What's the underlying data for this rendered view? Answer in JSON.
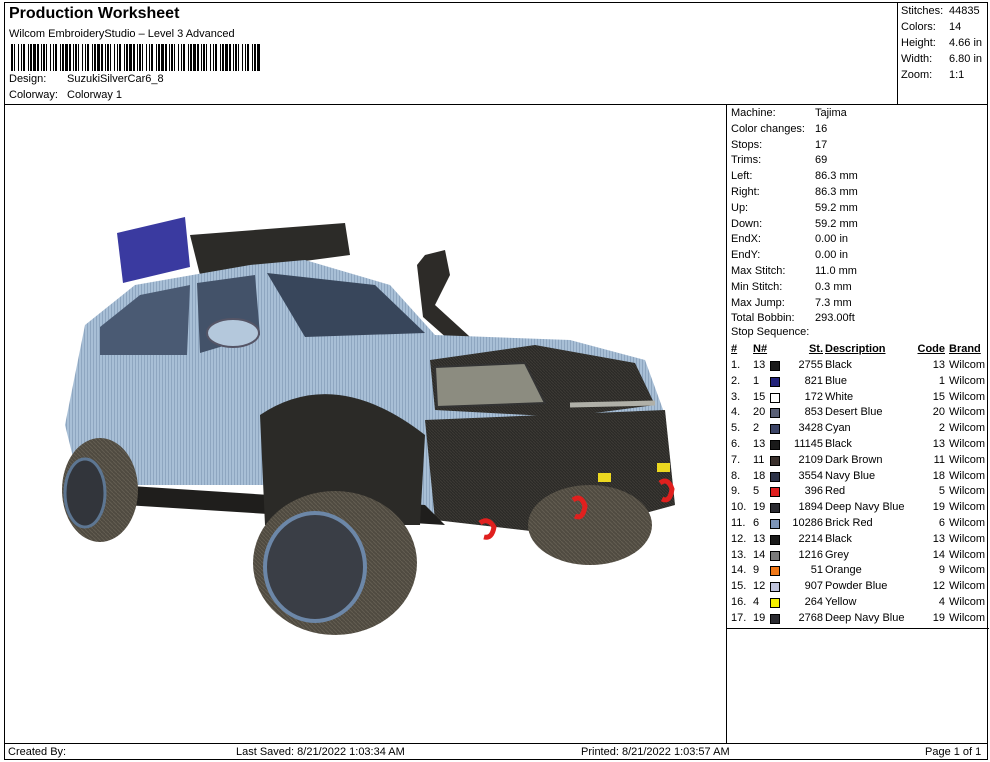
{
  "header": {
    "title": "Production Worksheet",
    "subtitle": "Wilcom EmbroideryStudio – Level 3 Advanced",
    "design_label": "Design:",
    "design_value": "SuzukiSilverCar6_8",
    "colorway_label": "Colorway:",
    "colorway_value": "Colorway 1"
  },
  "info": [
    {
      "label": "Stitches:",
      "value": "44835"
    },
    {
      "label": "Colors:",
      "value": "14"
    },
    {
      "label": "Height:",
      "value": "4.66 in"
    },
    {
      "label": "Width:",
      "value": "6.80 in"
    },
    {
      "label": "Zoom:",
      "value": "1:1"
    }
  ],
  "machine": [
    {
      "label": "Machine:",
      "value": "Tajima"
    },
    {
      "label": "Color changes:",
      "value": "16"
    },
    {
      "label": "Stops:",
      "value": "17"
    },
    {
      "label": "Trims:",
      "value": "69"
    },
    {
      "label": "Left:",
      "value": "86.3 mm"
    },
    {
      "label": "Right:",
      "value": "86.3 mm"
    },
    {
      "label": "Up:",
      "value": "59.2 mm"
    },
    {
      "label": "Down:",
      "value": "59.2 mm"
    },
    {
      "label": "EndX:",
      "value": "0.00 in"
    },
    {
      "label": "EndY:",
      "value": "0.00 in"
    },
    {
      "label": "Max Stitch:",
      "value": "11.0 mm"
    },
    {
      "label": "Min Stitch:",
      "value": "0.3 mm"
    },
    {
      "label": "Max Jump:",
      "value": "7.3 mm"
    },
    {
      "label": "Total Bobbin:",
      "value": "293.00ft"
    }
  ],
  "stop_sequence": {
    "title": "Stop Sequence:",
    "headers": {
      "idx": "#",
      "n": "N#",
      "st": "St.",
      "desc": "Description",
      "code": "Code",
      "brand": "Brand"
    },
    "rows": [
      {
        "idx": "1.",
        "n": "13",
        "color": "#1a1a1a",
        "st": "2755",
        "desc": "Black",
        "code": "13",
        "brand": "Wilcom"
      },
      {
        "idx": "2.",
        "n": "1",
        "color": "#22227a",
        "st": "821",
        "desc": "Blue",
        "code": "1",
        "brand": "Wilcom"
      },
      {
        "idx": "3.",
        "n": "15",
        "color": "#ffffff",
        "st": "172",
        "desc": "White",
        "code": "15",
        "brand": "Wilcom"
      },
      {
        "idx": "4.",
        "n": "20",
        "color": "#5a6076",
        "st": "853",
        "desc": "Desert Blue",
        "code": "20",
        "brand": "Wilcom"
      },
      {
        "idx": "5.",
        "n": "2",
        "color": "#3c4466",
        "st": "3428",
        "desc": "Cyan",
        "code": "2",
        "brand": "Wilcom"
      },
      {
        "idx": "6.",
        "n": "13",
        "color": "#1a1a1a",
        "st": "11145",
        "desc": "Black",
        "code": "13",
        "brand": "Wilcom"
      },
      {
        "idx": "7.",
        "n": "11",
        "color": "#3a302c",
        "st": "2109",
        "desc": "Dark Brown",
        "code": "11",
        "brand": "Wilcom"
      },
      {
        "idx": "8.",
        "n": "18",
        "color": "#2c3248",
        "st": "3554",
        "desc": "Navy Blue",
        "code": "18",
        "brand": "Wilcom"
      },
      {
        "idx": "9.",
        "n": "5",
        "color": "#e02020",
        "st": "396",
        "desc": "Red",
        "code": "5",
        "brand": "Wilcom"
      },
      {
        "idx": "10.",
        "n": "19",
        "color": "#2a2a30",
        "st": "1894",
        "desc": "Deep Navy Blue",
        "code": "19",
        "brand": "Wilcom"
      },
      {
        "idx": "11.",
        "n": "6",
        "color": "#7c94b8",
        "st": "10286",
        "desc": "Brick Red",
        "code": "6",
        "brand": "Wilcom"
      },
      {
        "idx": "12.",
        "n": "13",
        "color": "#1a1a1a",
        "st": "2214",
        "desc": "Black",
        "code": "13",
        "brand": "Wilcom"
      },
      {
        "idx": "13.",
        "n": "14",
        "color": "#7a7a7a",
        "st": "1216",
        "desc": "Grey",
        "code": "14",
        "brand": "Wilcom"
      },
      {
        "idx": "14.",
        "n": "9",
        "color": "#f07818",
        "st": "51",
        "desc": "Orange",
        "code": "9",
        "brand": "Wilcom"
      },
      {
        "idx": "15.",
        "n": "12",
        "color": "#c0c4dc",
        "st": "907",
        "desc": "Powder Blue",
        "code": "12",
        "brand": "Wilcom"
      },
      {
        "idx": "16.",
        "n": "4",
        "color": "#f4f000",
        "st": "264",
        "desc": "Yellow",
        "code": "4",
        "brand": "Wilcom"
      },
      {
        "idx": "17.",
        "n": "19",
        "color": "#2a2a30",
        "st": "2768",
        "desc": "Deep Navy Blue",
        "code": "19",
        "brand": "Wilcom"
      }
    ]
  },
  "footer": {
    "created": "Created By:",
    "saved": "Last Saved: 8/21/2022 1:03:34 AM",
    "printed": "Printed: 8/21/2022 1:03:57 AM",
    "page": "Page 1 of 1"
  }
}
